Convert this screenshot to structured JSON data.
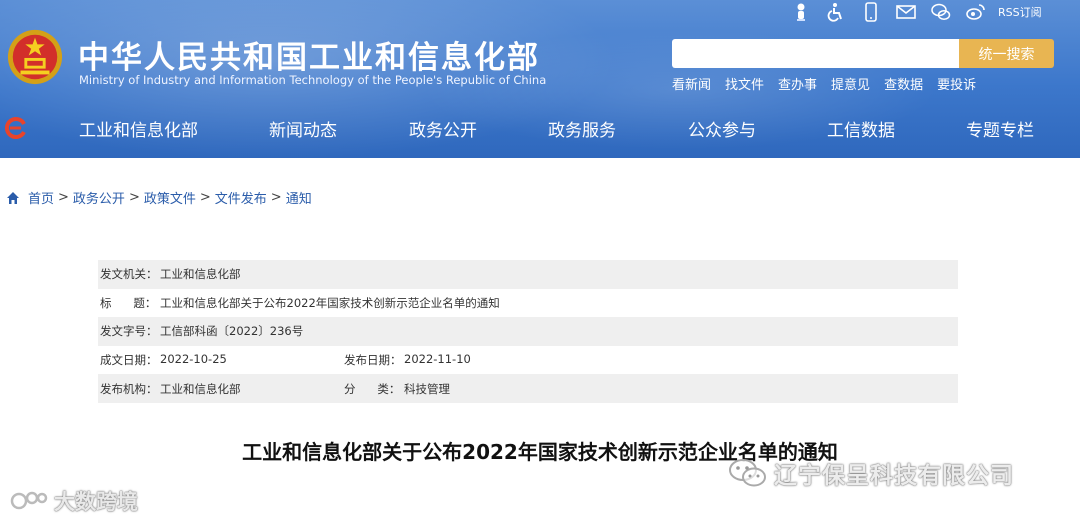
{
  "header": {
    "title_cn": "中华人民共和国工业和信息化部",
    "title_en": "Ministry of Industry and Information Technology of the People's Republic of China",
    "top_icons": [
      "mascot-icon",
      "accessibility-icon",
      "mobile-icon",
      "mail-icon",
      "weixin-icon",
      "weibo-icon"
    ],
    "rss_label": "RSS订阅",
    "search": {
      "placeholder": "",
      "button_label": "统一搜索"
    },
    "quick_links": [
      "看新闻",
      "找文件",
      "查办事",
      "提意见",
      "查数据",
      "要投诉"
    ],
    "nav": [
      "工业和信息化部",
      "新闻动态",
      "政务公开",
      "政务服务",
      "公众参与",
      "工信数据",
      "专题专栏"
    ]
  },
  "breadcrumb": [
    "首页",
    "政务公开",
    "政策文件",
    "文件发布",
    "通知"
  ],
  "info": {
    "issuer_label": "发文机关：",
    "issuer": "工业和信息化部",
    "title_label": "标      题：",
    "title": "工业和信息化部关于公布2022年国家技术创新示范企业名单的通知",
    "doc_no_label": "发文字号：",
    "doc_no": "工信部科函〔2022〕236号",
    "written_date_label": "成文日期：",
    "written_date": "2022-10-25",
    "publish_date_label": "发布日期：",
    "publish_date": "2022-11-10",
    "publisher_label": "发布机构：",
    "publisher": "工业和信息化部",
    "category_label": "分      类：",
    "category": "科技管理"
  },
  "document_title": "工业和信息化部关于公布2022年国家技术创新示范企业名单的通知",
  "watermarks": {
    "left": "大数跨境",
    "right": "辽宁保呈科技有限公司"
  },
  "colors": {
    "header_blue": "#3c77cb",
    "search_button": "#e8b552",
    "link_blue": "#2a5caa",
    "row_shade": "#efefef"
  }
}
